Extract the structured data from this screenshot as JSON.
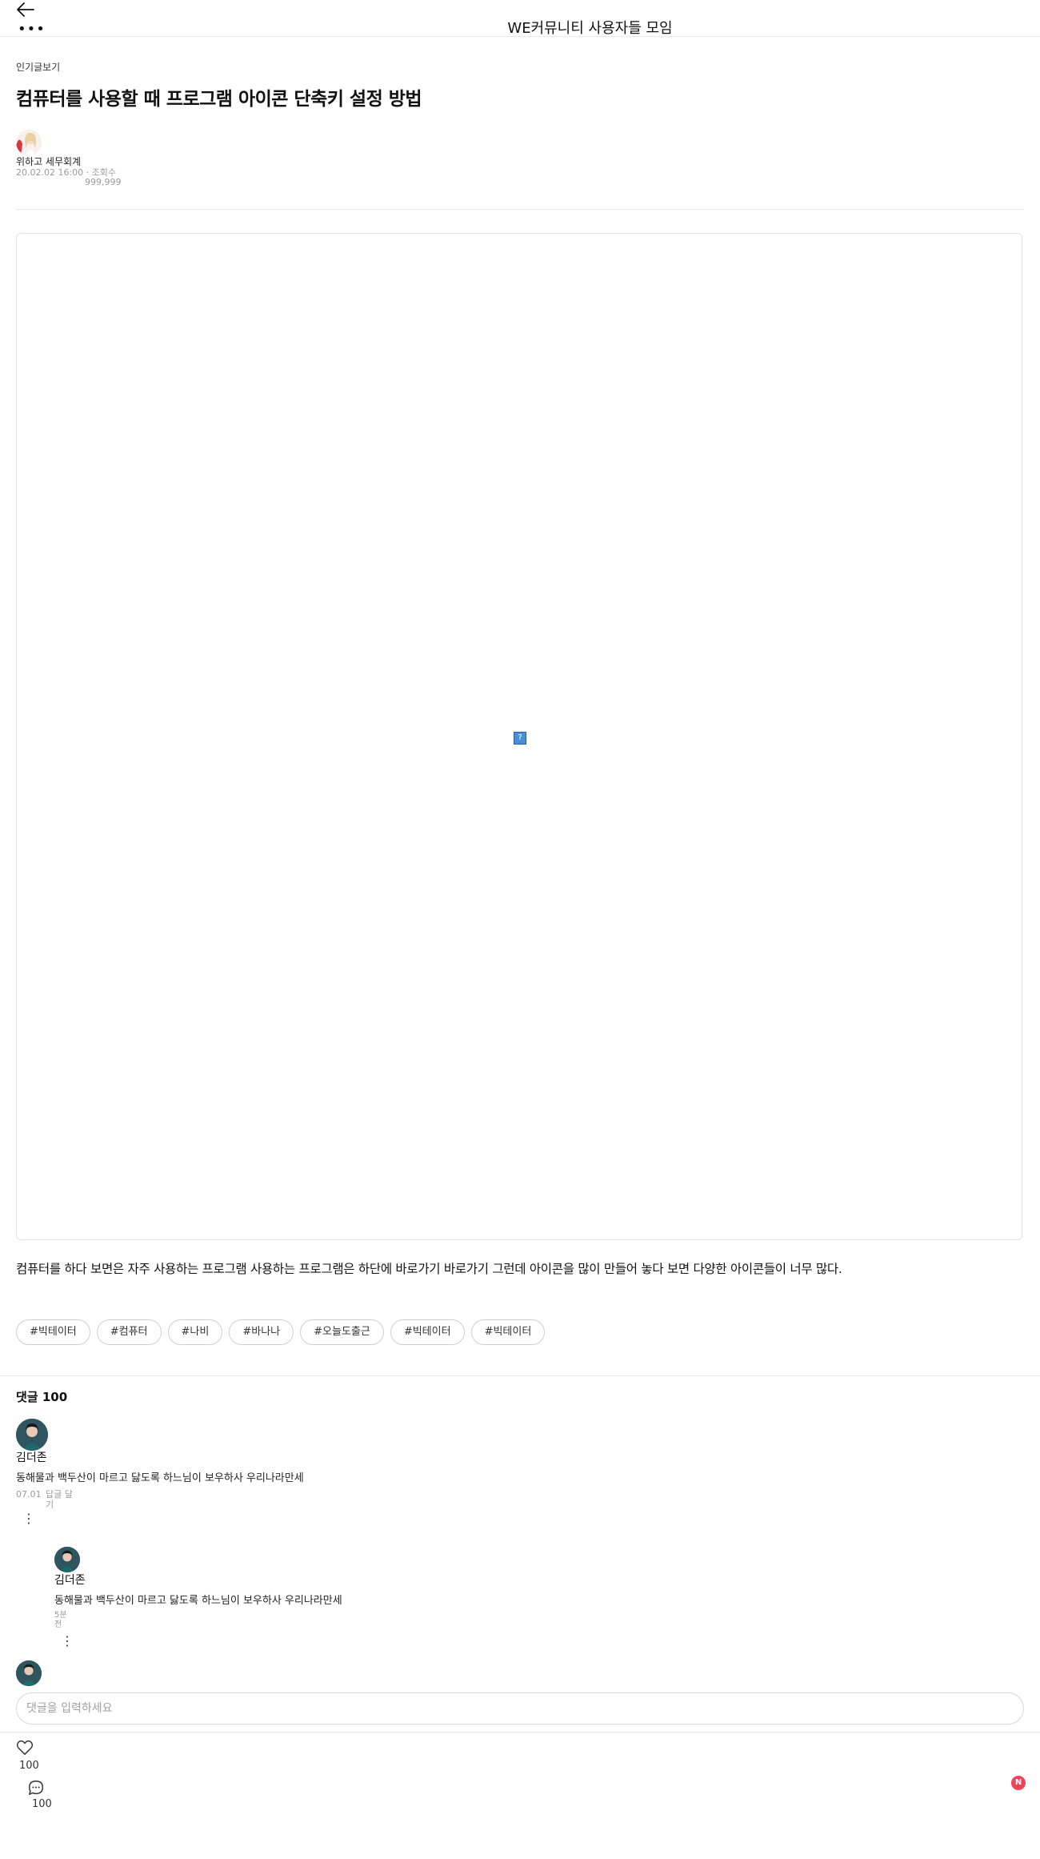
{
  "header": {
    "title": "WE커뮤니티 사용자들 모임",
    "more_label": "•••"
  },
  "post": {
    "category": "인기글보기",
    "title": "컴퓨터를 사용할 때 프로그램 아이콘 단축키 설정 방법",
    "author": "위하고 세무회계",
    "date": "20.02.02 16:00 · 조회수",
    "views": "999,999",
    "body": "컴퓨터를 하다 보면은 자주 사용하는 프로그램 사용하는 프로그램은 하단에 바로가기 바로가기 그런데 아이콘을 많이 만들어 놓다 보면 다양한 아이콘들이 너무 많다.",
    "broken_image_glyph": "?",
    "tags": [
      "#빅테이터",
      "#컴퓨터",
      "#나비",
      "#바나나",
      "#오늘도출근",
      "#빅테이터",
      "#빅테이터"
    ]
  },
  "comments": {
    "title": "댓글 100",
    "items": [
      {
        "name": "김더존",
        "text": "동해물과 백두산이 마르고 닳도록 하느님이 보우하사 우리나라만세",
        "date": "07.01",
        "reply_label": "답글 달기",
        "menu": "⋮"
      },
      {
        "name": "김더존",
        "text": "동해물과 백두산이 마르고 닳도록 하느님이 보우하사 우리나라만세",
        "date": "5분 전",
        "menu": "⋮"
      }
    ],
    "input_placeholder": "댓글을 입력하세요"
  },
  "footer": {
    "like_count": "100",
    "comment_count": "100",
    "notification_badge": "N"
  },
  "icons": [
    "back-arrow-icon",
    "more-icon",
    "heart-icon",
    "chat-bubble-icon",
    "broken-image-icon"
  ]
}
